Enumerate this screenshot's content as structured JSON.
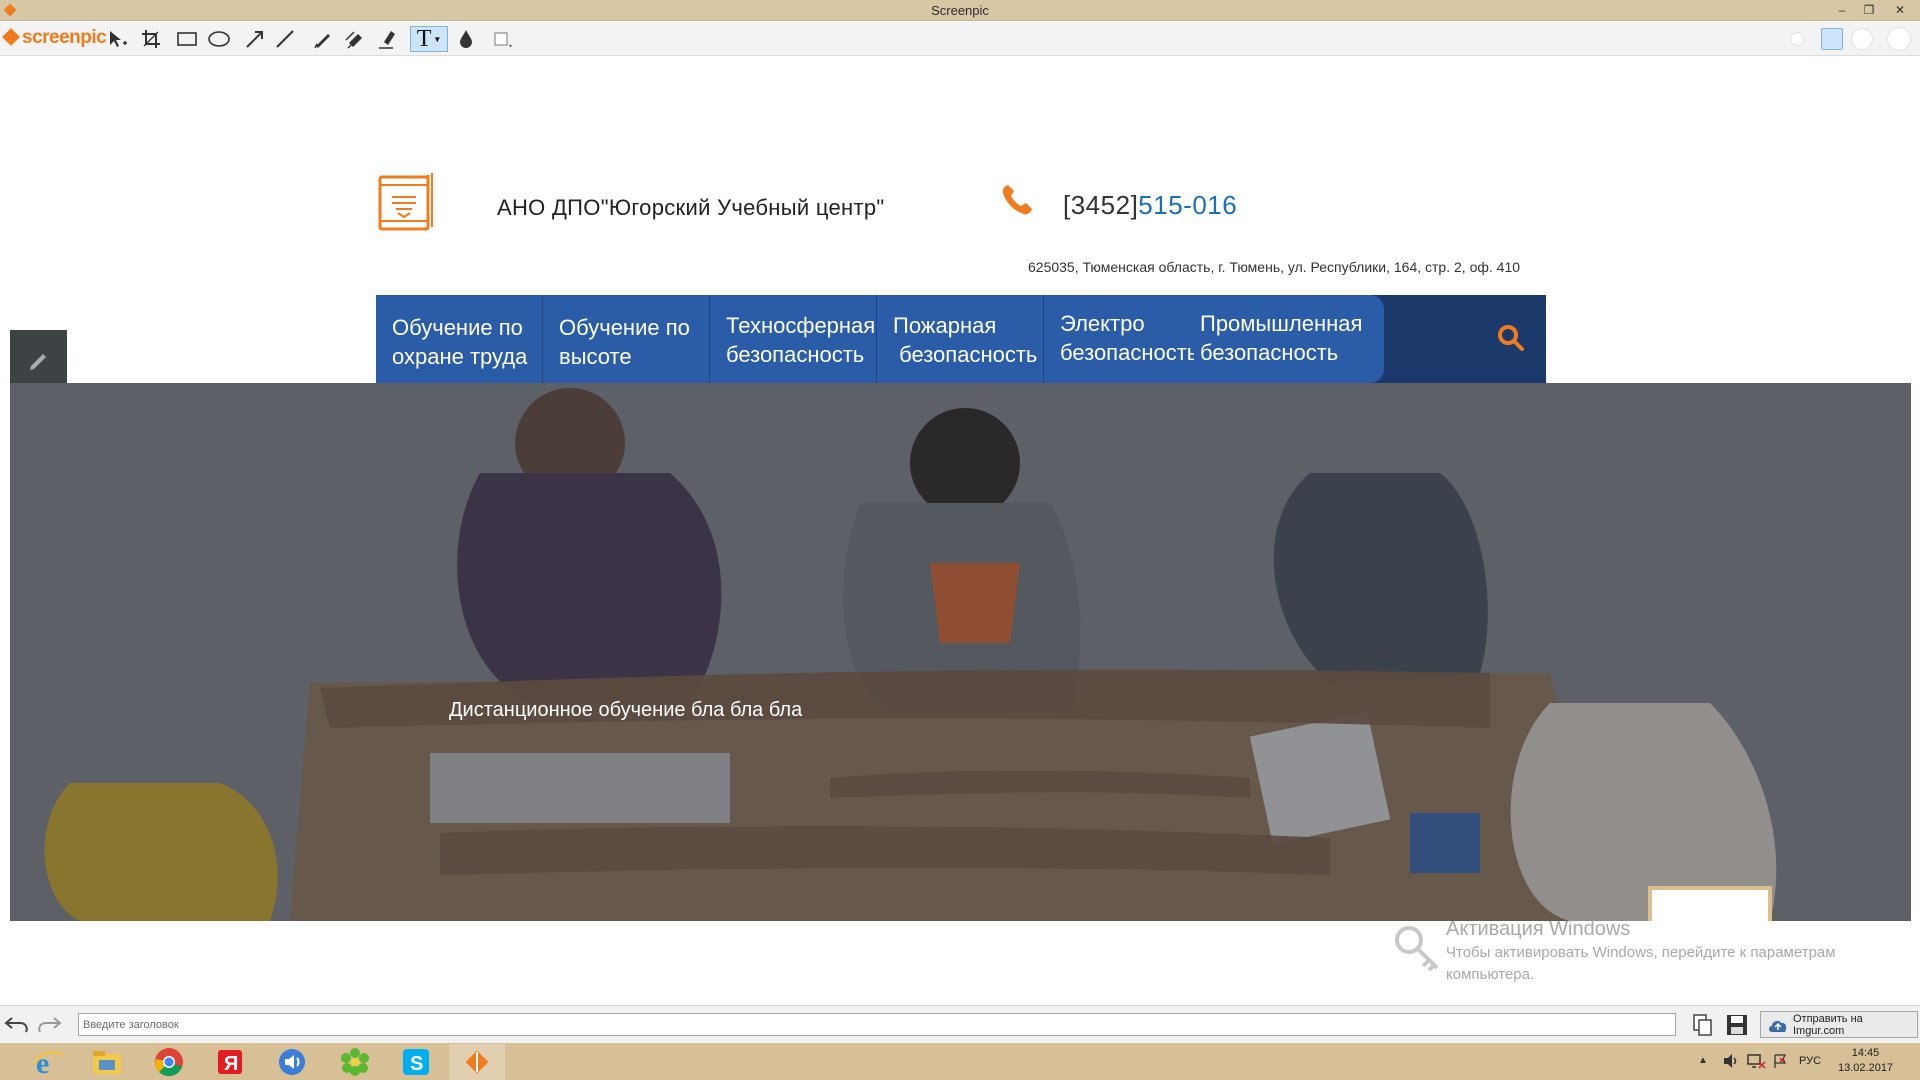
{
  "window": {
    "title": "Screenpic"
  },
  "toolbar": {
    "logo_text": "screenpic",
    "tools": [
      "select-icon",
      "crop-icon",
      "rectangle-icon",
      "ellipse-icon",
      "arrow-icon",
      "line-icon",
      "pen-icon",
      "marker-icon",
      "highlighter-icon",
      "text-icon",
      "blur-drop-icon",
      "color-box-icon"
    ],
    "active_tool": "text-icon",
    "text_tool_label": "T"
  },
  "page": {
    "org_name": "АНО ДПО\"Югорский Учебный центр\"",
    "phone_code": "[3452]",
    "phone_number": "515-016",
    "address": "625035, Тюменская область, г. Тюмень, ул. Республики, 164, стр. 2, оф. 410",
    "nav": [
      {
        "line1": "Обучение по",
        "line2": "охране труда"
      },
      {
        "line1": "Обучение по",
        "line2": "высоте"
      },
      {
        "line1": "Техносферная",
        "line2": "безопасность"
      },
      {
        "line1": "Пожарная",
        "line2": " безопасность"
      },
      {
        "line1": "Электро",
        "line2": "безопасность"
      },
      {
        "line1": "Промышленная",
        "line2": "безопасность"
      }
    ],
    "hero_caption": "Дистанционное обучение бла бла бла"
  },
  "activation": {
    "title": "Активация Windows",
    "line1": "Чтобы активировать Windows, перейдите к параметрам",
    "line2": "компьютера."
  },
  "bottom": {
    "title_placeholder": "Введите заголовок",
    "upload_label": "Отправить на Imgur.com"
  },
  "taskbar": {
    "apps": [
      "ie-icon",
      "explorer-icon",
      "chrome-icon",
      "yandex-icon",
      "audio-icon",
      "icq-icon",
      "skype-icon",
      "screenpic-icon"
    ],
    "lang": "РУС",
    "time": "14:45",
    "date": "13.02.2017"
  },
  "colors": {
    "nav_blue": "#2a5ca8",
    "nav_dark": "#1b3a6b",
    "accent_orange": "#f07c1e",
    "phone_blue": "#1d6fb8"
  }
}
